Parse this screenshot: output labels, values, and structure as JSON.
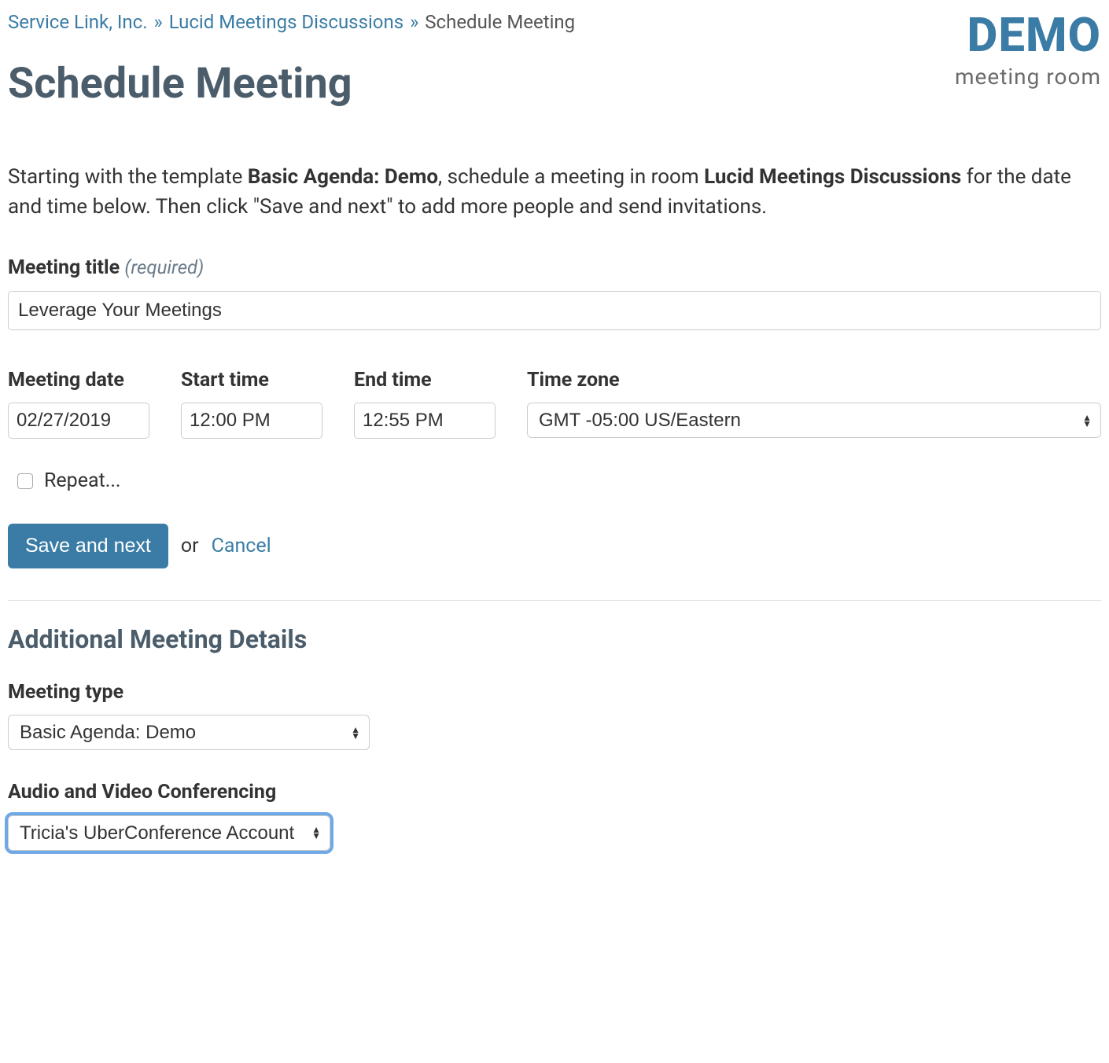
{
  "breadcrumb": {
    "link1": "Service Link, Inc.",
    "link2": "Lucid Meetings Discussions",
    "current": "Schedule Meeting"
  },
  "pageTitle": "Schedule Meeting",
  "logo": {
    "main": "DEMO",
    "sub": "meeting room"
  },
  "intro": {
    "prefix": "Starting with the template ",
    "template": "Basic Agenda: Demo",
    "mid1": ", schedule a meeting in room ",
    "room": "Lucid Meetings Discussions",
    "suffix": " for the date and time below. Then click \"Save and next\" to add more people and send invitations."
  },
  "fields": {
    "titleLabel": "Meeting title",
    "requiredHint": "(required)",
    "titleValue": "Leverage Your Meetings",
    "dateLabel": "Meeting date",
    "dateValue": "02/27/2019",
    "startLabel": "Start time",
    "startValue": "12:00 PM",
    "endLabel": "End time",
    "endValue": "12:55 PM",
    "tzLabel": "Time zone",
    "tzValue": "GMT -05:00 US/Eastern",
    "repeatLabel": "Repeat..."
  },
  "actions": {
    "save": "Save and next",
    "or": "or",
    "cancel": "Cancel"
  },
  "details": {
    "heading": "Additional Meeting Details",
    "typeLabel": "Meeting type",
    "typeValue": "Basic Agenda: Demo",
    "avLabel": "Audio and Video Conferencing",
    "avValue": "Tricia's UberConference Account"
  }
}
